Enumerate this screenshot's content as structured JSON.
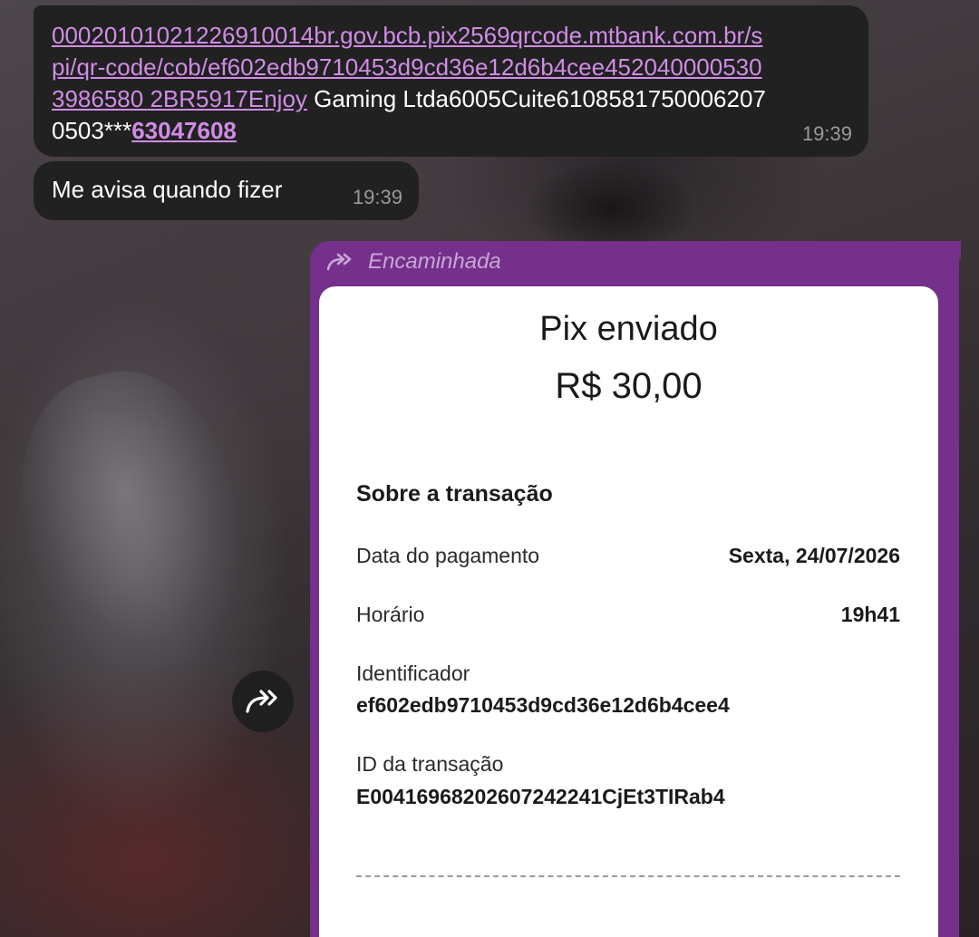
{
  "messages": [
    {
      "link_text": "00020101021226910014br.gov.bcb.pix2569qrcode.mtbank.com.br/spi/qr-code/cob/ef602edb9710453d9cd36e12d6b4cee4520400005303986580 2BR5917Enjoy",
      "plain_text": " Gaming Ltda6005Cuite61085817500062070503***",
      "bold_link_text": "63047608",
      "time": "19:39"
    },
    {
      "text": "Me avisa quando fizer",
      "time": "19:39"
    }
  ],
  "forwarded": {
    "label": "Encaminhada",
    "receipt": {
      "title": "Pix enviado",
      "amount": "R$ 30,00",
      "section_title": "Sobre a transação",
      "fields": [
        {
          "label": "Data do pagamento",
          "value": "Sexta, 24/07/2026"
        },
        {
          "label": "Horário",
          "value": "19h41"
        },
        {
          "label": "Identificador",
          "value": "ef602edb9710453d9cd36e12d6b4cee4"
        },
        {
          "label": "ID da transação",
          "value": "E00416968202607242241CjEt3TIRab4"
        }
      ]
    }
  },
  "colors": {
    "bubble": "#212121",
    "link": "#d08ce6",
    "forward_accent": "#74308b"
  },
  "icons": {
    "forward_label_icon": "forward-arrows-icon",
    "share_button_icon": "forward-arrows-icon"
  }
}
